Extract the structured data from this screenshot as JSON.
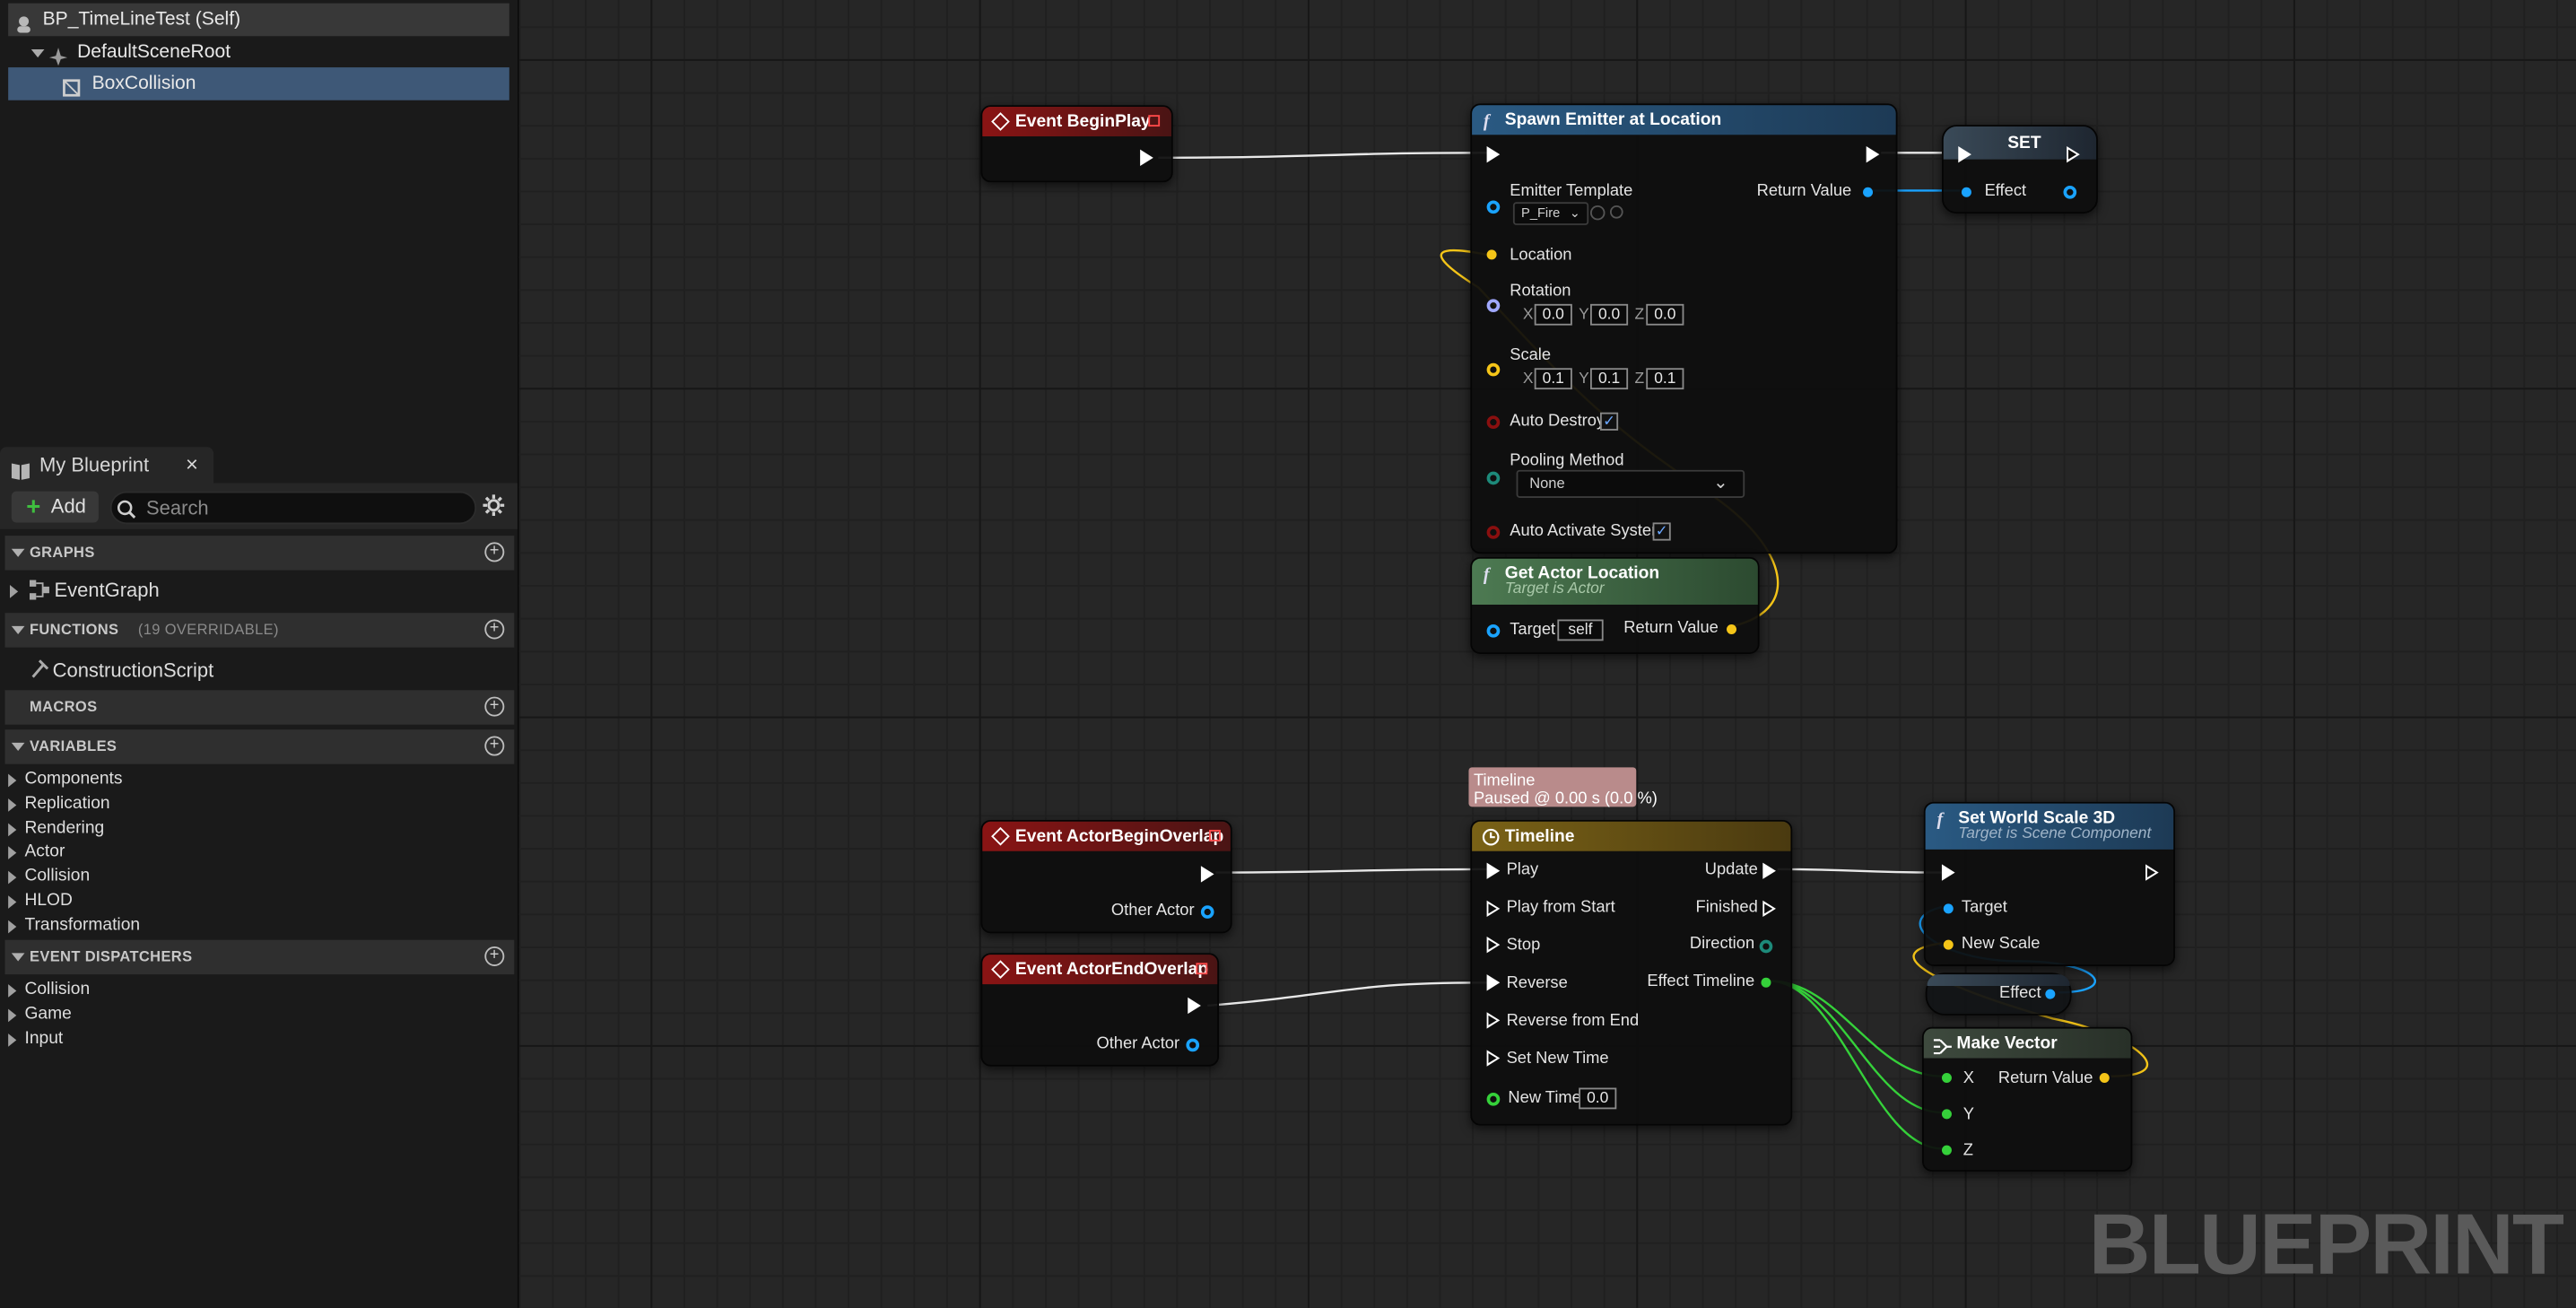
{
  "components": {
    "self": "BP_TimeLineTest (Self)",
    "root": "DefaultSceneRoot",
    "child": "BoxCollision"
  },
  "my_blueprint": {
    "tab": "My Blueprint",
    "close": "×",
    "add": "Add",
    "search_placeholder": "Search",
    "graphs_header": "GRAPHS",
    "event_graph": "EventGraph",
    "functions_header": "FUNCTIONS",
    "functions_sub": "(19 OVERRIDABLE)",
    "construction_script": "ConstructionScript",
    "macros_header": "MACROS",
    "variables_header": "VARIABLES",
    "variable_categories": [
      "Components",
      "Replication",
      "Rendering",
      "Actor",
      "Collision",
      "HLOD",
      "Transformation"
    ],
    "dispatchers_header": "EVENT DISPATCHERS",
    "dispatcher_categories": [
      "Collision",
      "Game",
      "Input"
    ]
  },
  "graph": {
    "watermark": "BLUEPRINT",
    "begin_play": {
      "title": "Event BeginPlay"
    },
    "spawn": {
      "title": "Spawn Emitter at Location",
      "emitter_template": "Emitter Template",
      "template_value": "P_Fire",
      "return_value": "Return Value",
      "location": "Location",
      "rotation": "Rotation",
      "rot_x": "0.0",
      "rot_y": "0.0",
      "rot_z": "0.0",
      "scale": "Scale",
      "scale_x": "0.1",
      "scale_y": "0.1",
      "scale_z": "0.1",
      "auto_destroy": "Auto Destroy",
      "pooling_method": "Pooling Method",
      "pooling_value": "None",
      "auto_activate": "Auto Activate System",
      "axis_x": "X",
      "axis_y": "Y",
      "axis_z": "Z"
    },
    "set": {
      "title": "SET",
      "effect": "Effect"
    },
    "get_actor_location": {
      "title": "Get Actor Location",
      "subtitle": "Target is Actor",
      "target": "Target",
      "target_value": "self",
      "return_value": "Return Value"
    },
    "timeline_comment": {
      "line1": "Timeline",
      "line2": "Paused @ 0.00 s (0.0 %)"
    },
    "begin_overlap": {
      "title": "Event ActorBeginOverlap",
      "other_actor": "Other Actor"
    },
    "end_overlap": {
      "title": "Event ActorEndOverlap",
      "other_actor": "Other Actor"
    },
    "timeline": {
      "title": "Timeline",
      "play": "Play",
      "play_from_start": "Play from Start",
      "stop": "Stop",
      "reverse": "Reverse",
      "reverse_from_end": "Reverse from End",
      "set_new_time": "Set New Time",
      "new_time": "New Time",
      "new_time_value": "0.0",
      "update": "Update",
      "finished": "Finished",
      "direction": "Direction",
      "effect_timeline": "Effect Timeline"
    },
    "set_world_scale": {
      "title": "Set World Scale 3D",
      "subtitle": "Target is Scene Component",
      "target": "Target",
      "new_scale": "New Scale"
    },
    "effect_get": {
      "label": "Effect"
    },
    "make_vector": {
      "title": "Make Vector",
      "x": "X",
      "y": "Y",
      "z": "Z",
      "return_value": "Return Value"
    }
  },
  "colors": {
    "event_header": "#8a1414",
    "function_header": "#2a5a83",
    "pure_header": "#4d7a52",
    "timeline_header": "#7a6216",
    "object_pin": "#1aa3ff",
    "vector_pin": "#f5c518",
    "float_pin": "#35d13a",
    "bool_pin": "#8a0f0f",
    "selection": "#3e5877"
  }
}
